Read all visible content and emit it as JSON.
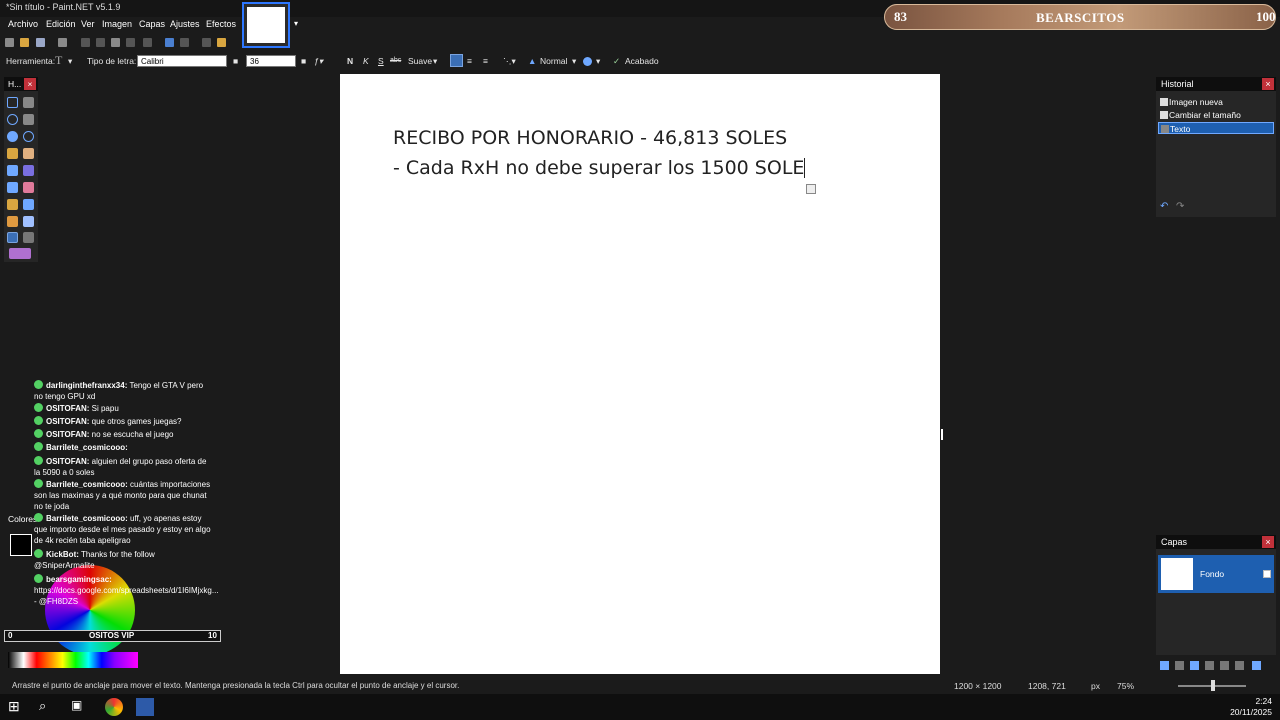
{
  "window": {
    "title": "*Sin título - Paint.NET v5.1.9"
  },
  "menu": [
    "Archivo",
    "Edición",
    "Ver",
    "Imagen",
    "Capas",
    "Ajustes",
    "Efectos"
  ],
  "toolbar": {
    "tool_label": "Herramienta:",
    "font_label": "Tipo de letra:",
    "font_value": "Calibri",
    "size_value": "36",
    "bold": "N",
    "italic": "K",
    "underline": "S",
    "strike": "abc",
    "antialias": "Suave",
    "blend": "Normal",
    "finish": "Acabado"
  },
  "banner": {
    "left_num": "83",
    "name": "BEARSCITOS",
    "right_num": "100"
  },
  "tools_panel": {
    "title": "H..."
  },
  "canvas": {
    "line1": "RECIBO POR HONORARIO - 46,813 SOLES",
    "line2": "- Cada RxH no debe superar los 1500 SOLE"
  },
  "history": {
    "title": "Historial",
    "items": [
      "Imagen nueva",
      "Cambiar el tamaño",
      "Texto"
    ]
  },
  "layers": {
    "title": "Capas",
    "layer_name": "Fondo"
  },
  "colors": {
    "title": "Colores"
  },
  "chat": [
    {
      "user": "darlinginthefranxx34:",
      "msg": " Tengo el GTA V pero no tengo GPU xd"
    },
    {
      "user": "OSITOFAN:",
      "msg": " Si papu"
    },
    {
      "user": "OSITOFAN:",
      "msg": " que otros games juegas?"
    },
    {
      "user": "OSITOFAN:",
      "msg": " no se escucha el juego"
    },
    {
      "user": "Barrilete_cosmicooo:",
      "msg": ""
    },
    {
      "user": "OSITOFAN:",
      "msg": " alguien del grupo paso oferta de la 5090 a 0 soles"
    },
    {
      "user": "Barrilete_cosmicooo:",
      "msg": " cuántas importaciones son las maximas y a qué monto para que chunat no te joda"
    },
    {
      "user": "Barrilete_cosmicooo:",
      "msg": " uff, yo apenas estoy que importo desde el mes pasado y estoy en algo de 4k recién taba apeligrao"
    },
    {
      "user": "KickBot:",
      "msg": " Thanks for the follow @SniperArmalite"
    },
    {
      "user": "bearsgamingsac:",
      "msg": " https://docs.google.com/spreadsheets/d/1I6IMjxkg... - @FH8DZS"
    }
  ],
  "vip_bar": {
    "left": "0",
    "label": "OSITOS VIP",
    "right": "10"
  },
  "status": {
    "message": "Arrastre el punto de anclaje para mover el texto. Mantenga presionada la tecla Ctrl para ocultar el punto de anclaje y el cursor.",
    "image_size": "1200 × 1200",
    "cursor_pos": "1208, 721",
    "units": "px",
    "zoom": "75%"
  },
  "clock": {
    "time": "2:24",
    "date": "20/11/2025"
  }
}
